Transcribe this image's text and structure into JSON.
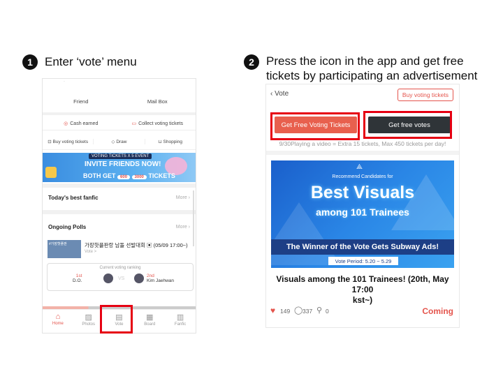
{
  "steps": [
    {
      "number": "1",
      "text": "Enter ‘vote’ menu"
    },
    {
      "number": "2",
      "line1": "Press the icon in the app and get free",
      "line2": "tickets by participating an advertisement"
    }
  ],
  "left_app": {
    "top_partial": "·",
    "friend_label": "Friend",
    "mailbox_label": "Mail Box",
    "cash_earned": "Cash earned",
    "collect_tickets": "Collect voting tickets",
    "buy_tickets": "Buy voting tickets",
    "draw": "Draw",
    "shopping": "Shopping",
    "banner": {
      "badge": "VOTING TICKETS X 5  EVENT",
      "line1": "INVITE FRIENDS NOW!",
      "line2_a": "BOTH GET",
      "pill1": "600",
      "pill2": "3000",
      "line2_b": "TICKETS"
    },
    "best_fanfic": "Today's best fanfic",
    "more1": "More",
    "ongoing_polls": "Ongoing Polls",
    "more2": "More",
    "poll": {
      "thumb_text": "#가장핫플판",
      "title": "가장핫플판랑 남돌 선발대회 ▣ (05/09 17:00~)",
      "sub": "Vote >"
    },
    "ranking": {
      "caption": "Current voting ranking",
      "first_rank": "1st",
      "first_name": "D.O.",
      "vs": "VS",
      "second_rank": "2nd",
      "second_name": "Kim Jaehwan"
    },
    "nav": [
      "Home",
      "Photos",
      "Vote",
      "Board",
      "Fanfic"
    ]
  },
  "right_app": {
    "back_label": "Vote",
    "buy_button": "Buy voting tickets",
    "get_free_voting": "Get Free Voting Tickets",
    "get_free_votes": "Get free votes",
    "info": "9/30Playing a video = Extra 15 tickets, Max 450 tickets per day!",
    "banner": {
      "recommend": "Recommend Candidates for",
      "best_visuals": "Best Visuals",
      "among": "among 101 Trainees",
      "winner": "The Winner of the Vote Gets Subway Ads!",
      "period": "Vote Period: 5.20 ~ 5.29"
    },
    "title_line1": "Visuals among the 101 Trainees! (20th, May 17:00",
    "title_line2": "kst~)",
    "likes": "149",
    "comments": "337",
    "shares": "0",
    "status": "Coming"
  }
}
